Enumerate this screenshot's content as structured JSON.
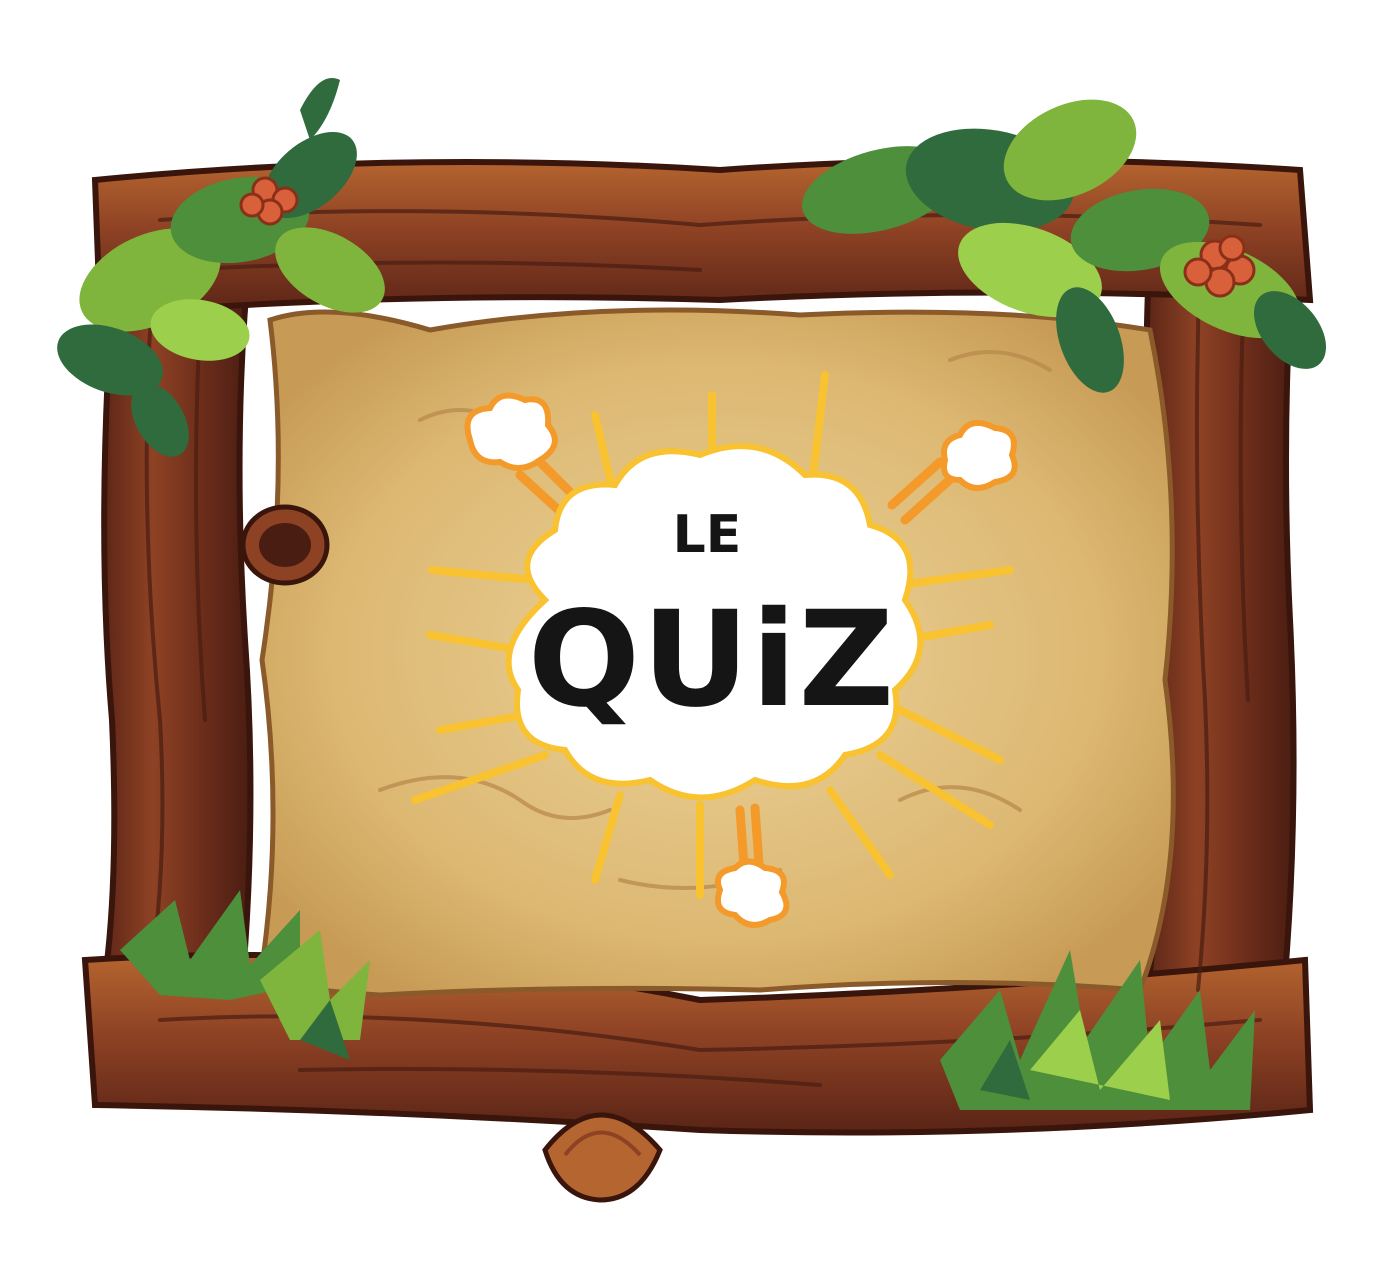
{
  "badge": {
    "line1": "LE",
    "line2": "QUiZ"
  },
  "colors": {
    "background": "#ffffff",
    "wood_dark": "#5a2416",
    "wood_mid": "#8e4224",
    "wood_light": "#b5652f",
    "parchment": "#e0bf7c",
    "parchment_light": "#ecd29a",
    "leaf_dark": "#2f6b3c",
    "leaf_light": "#7fb53d",
    "berry": "#d8603a",
    "burst_orange": "#f39a2a",
    "burst_yellow": "#f8c230",
    "cloud": "#ffffff",
    "text": "#151515"
  },
  "icons": {
    "badge": "comic-burst-cloud-icon",
    "foliage": "leaf-cluster-icon",
    "berries": "berry-icon",
    "mushroom": "mushroom-icon"
  }
}
